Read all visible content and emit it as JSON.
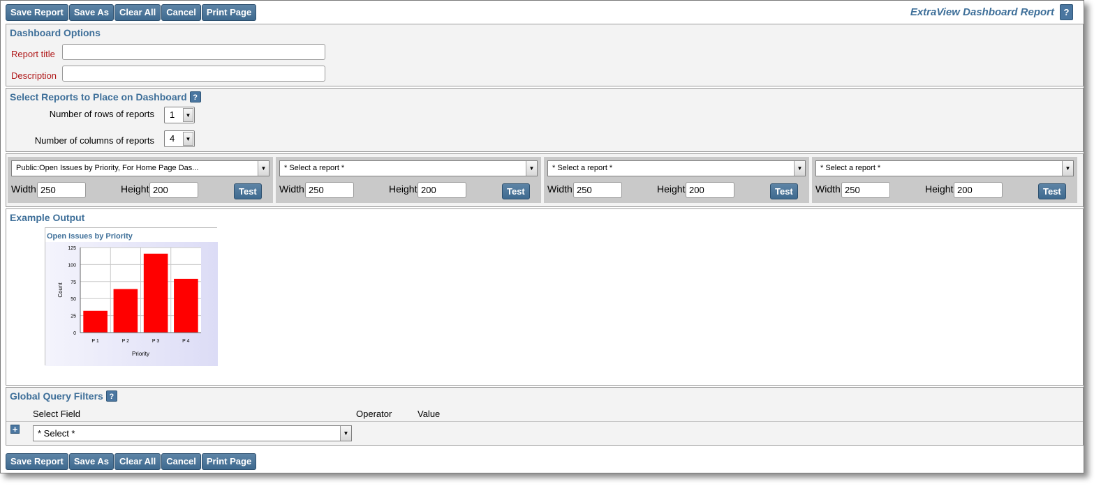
{
  "toolbar": {
    "buttons": [
      "Save Report",
      "Save As",
      "Clear All",
      "Cancel",
      "Print Page"
    ]
  },
  "app_title": "ExtraView Dashboard Report",
  "help_label": "?",
  "dashboard_options": {
    "title": "Dashboard Options",
    "report_title_label": "Report title",
    "report_title_value": "",
    "description_label": "Description",
    "description_value": ""
  },
  "select_reports": {
    "title": "Select Reports to Place on Dashboard",
    "rows_label": "Number of rows of reports",
    "rows_value": "1",
    "columns_label": "Number of columns of reports",
    "columns_value": "4"
  },
  "report_panels": [
    {
      "report": "Public:Open Issues by Priority, For Home Page Das...",
      "width_label": "Width",
      "width": "250",
      "height_label": "Height",
      "height": "200",
      "test_label": "Test"
    },
    {
      "report": "* Select a report *",
      "width_label": "Width",
      "width": "250",
      "height_label": "Height",
      "height": "200",
      "test_label": "Test"
    },
    {
      "report": "* Select a report *",
      "width_label": "Width",
      "width": "250",
      "height_label": "Height",
      "height": "200",
      "test_label": "Test"
    },
    {
      "report": "* Select a report *",
      "width_label": "Width",
      "width": "250",
      "height_label": "Height",
      "height": "200",
      "test_label": "Test"
    }
  ],
  "example_output": {
    "title": "Example Output"
  },
  "chart_data": {
    "type": "bar",
    "title": "Open Issues by Priority",
    "xlabel": "Priority",
    "ylabel": "Count",
    "categories": [
      "P 1",
      "P 2",
      "P 3",
      "P 4"
    ],
    "values": [
      32,
      64,
      116,
      79
    ],
    "ylim": [
      0,
      125
    ],
    "yticks": [
      "0",
      "25",
      "50",
      "75",
      "100",
      "125"
    ],
    "grid": true,
    "bar_color": "#ff0000",
    "plot_background": "#e8e8f8"
  },
  "global_filters": {
    "title": "Global Query Filters",
    "col_field": "Select Field",
    "col_operator": "Operator",
    "col_value": "Value",
    "field_select": "* Select *",
    "add_icon": "plus-icon"
  },
  "colors": {
    "accent": "#3e6f99",
    "button": "#4a76a0",
    "required_label": "#b0191a"
  }
}
